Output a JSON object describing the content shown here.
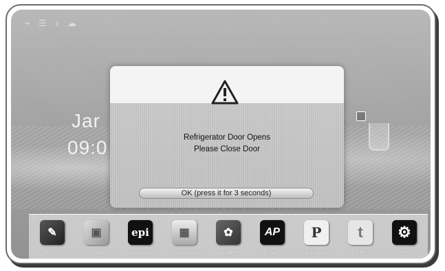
{
  "status_bar": {
    "icons": [
      "wifi-icon",
      "signal-icon",
      "speaker-icon",
      "cloud-icon"
    ]
  },
  "home": {
    "date_partial": "Jar",
    "time_partial": "09:0"
  },
  "alert_dialog": {
    "icon": "warning-icon",
    "line1": "Refrigerator Door Opens",
    "line2": "Please Close Door",
    "ok_button": "OK (press it for 3 seconds)"
  },
  "dock": {
    "apps": [
      {
        "label": "Memo",
        "icon": "memo-icon",
        "glyph": "✎"
      },
      {
        "label": "Photo",
        "icon": "photo-icon",
        "glyph": "▣"
      },
      {
        "label": "Epicurious",
        "icon": "epi-icon",
        "glyph": "epi"
      },
      {
        "label": "Calendar",
        "icon": "calendar-icon",
        "glyph": "▦"
      },
      {
        "label": "Weather",
        "icon": "weatherbug-icon",
        "glyph": "✿"
      },
      {
        "label": "AP News",
        "icon": "ap-icon",
        "glyph": "AP"
      },
      {
        "label": "Pandora",
        "icon": "pandora-icon",
        "glyph": "P"
      },
      {
        "label": "Twitter",
        "icon": "twitter-icon",
        "glyph": "t"
      },
      {
        "label": "Settings",
        "icon": "gear-icon",
        "glyph": "⚙"
      }
    ]
  }
}
